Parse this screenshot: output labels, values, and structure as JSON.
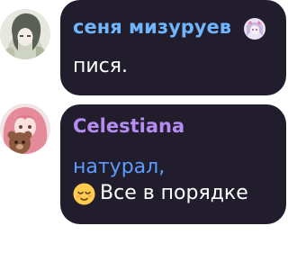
{
  "messages": [
    {
      "sender": "сеня мизуруев",
      "text": "пися.",
      "sender_color": "#6fb6ff",
      "avatar_icon": "anime-girl-avatar-icon",
      "badge_icon": "anime-sticker-badge-icon"
    },
    {
      "sender": "Celestiana",
      "text_line1": "натурал,",
      "text_line2": "Все в порядке",
      "text_line1_color": "#5c9bff",
      "sender_color": "#b58df2",
      "avatar_icon": "pink-hair-girl-avatar-icon",
      "emoji_icon": "relieved-face-emoji-icon"
    }
  ],
  "bubble_color": "#211d2c"
}
